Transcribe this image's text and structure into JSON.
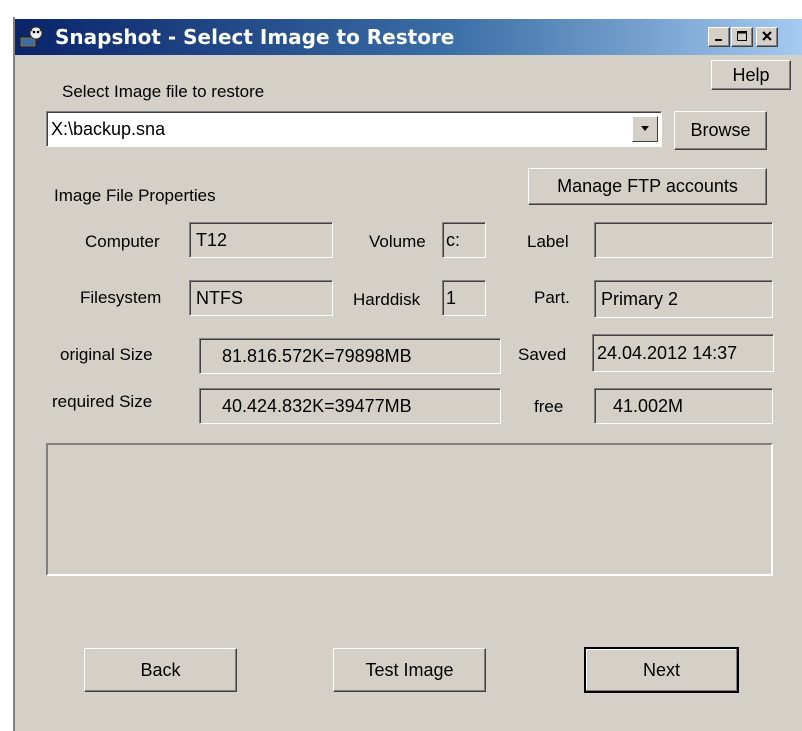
{
  "window": {
    "title": "Snapshot - Select Image to Restore",
    "minimize": "_",
    "close": "×"
  },
  "help_label": "Help",
  "select_label": "Select Image file to restore",
  "image_path": "X:\\backup.sna",
  "browse_label": "Browse",
  "properties_label": "Image File Properties",
  "ftp_label": "Manage FTP accounts",
  "fields": {
    "computer": {
      "label": "Computer",
      "value": "T12"
    },
    "volume": {
      "label": "Volume",
      "value": "c:"
    },
    "label": {
      "label": "Label",
      "value": ""
    },
    "filesystem": {
      "label": "Filesystem",
      "value": "NTFS"
    },
    "harddisk": {
      "label": "Harddisk",
      "value": "1"
    },
    "part": {
      "label": "Part.",
      "value": "Primary 2"
    },
    "original_size": {
      "label": "original Size",
      "value": "81.816.572K=79898MB"
    },
    "saved": {
      "label": "Saved",
      "value": "24.04.2012 14:37"
    },
    "required_size": {
      "label": "required Size",
      "value": "40.424.832K=39477MB"
    },
    "free": {
      "label": "free",
      "value": "41.002M"
    }
  },
  "buttons": {
    "back": "Back",
    "test": "Test Image",
    "next": "Next"
  }
}
